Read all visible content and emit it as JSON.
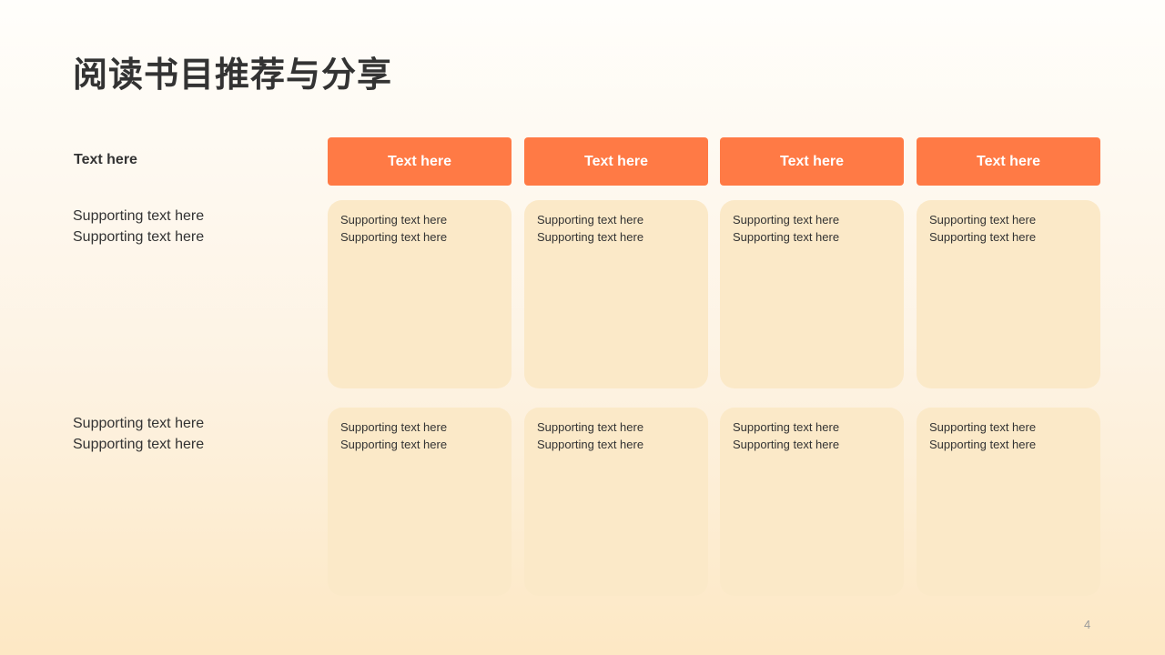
{
  "title": "阅读书目推荐与分享",
  "table": {
    "corner_header": "Text here",
    "column_headers": [
      "Text here",
      "Text here",
      "Text here",
      "Text here"
    ],
    "rows": [
      {
        "label_lines": [
          "Supporting text here",
          "Supporting text here"
        ],
        "cells": [
          [
            "Supporting  text here",
            "Supporting  text here"
          ],
          [
            "Supporting  text here",
            "Supporting  text here"
          ],
          [
            "Supporting  text here",
            "Supporting  text here"
          ],
          [
            "Supporting  text here",
            "Supporting  text here"
          ]
        ]
      },
      {
        "label_lines": [
          "Supporting text here",
          "Supporting text here"
        ],
        "cells": [
          [
            "Supporting  text here",
            "Supporting  text here"
          ],
          [
            "Supporting  text here",
            "Supporting  text here"
          ],
          [
            "Supporting  text here",
            "Supporting  text here"
          ],
          [
            "Supporting  text here",
            "Supporting  text here"
          ]
        ]
      }
    ]
  },
  "page_number": "4",
  "colors": {
    "header_orange": "#ff7a45",
    "cell_fill": "#fbe9c8",
    "text_dark": "#333333"
  }
}
